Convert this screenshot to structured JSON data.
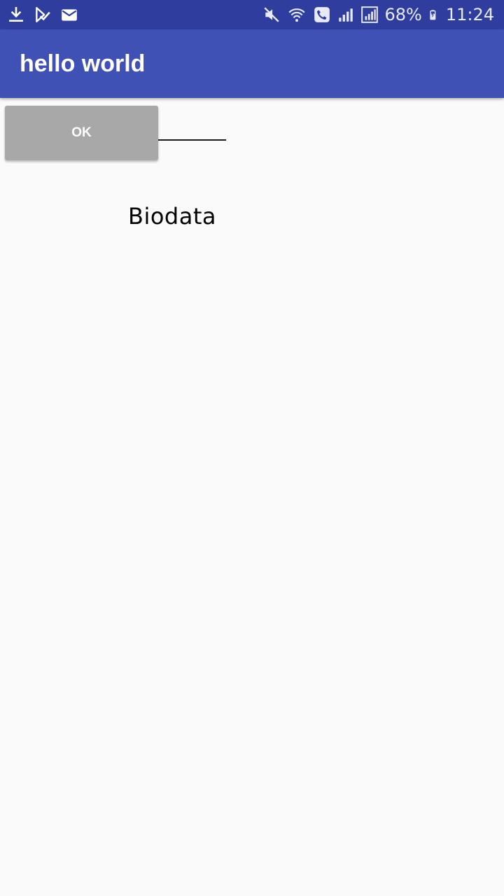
{
  "status_bar": {
    "left_icons": [
      "download-icon",
      "play-store-icon",
      "mail-icon"
    ],
    "right_icons": [
      "mute-icon",
      "wifi-call-icon",
      "signal-icon",
      "signal-full-icon",
      "battery-charging-icon"
    ],
    "battery_percent": "68%",
    "time": "11:24"
  },
  "app_bar": {
    "title": "hello world"
  },
  "main": {
    "ok_button_label": "OK",
    "biodata_label": "Biodata"
  },
  "colors": {
    "status_bar": "#2f3e9e",
    "app_bar": "#3f51b5",
    "background": "#fafafa",
    "button": "#a8a8a8"
  }
}
